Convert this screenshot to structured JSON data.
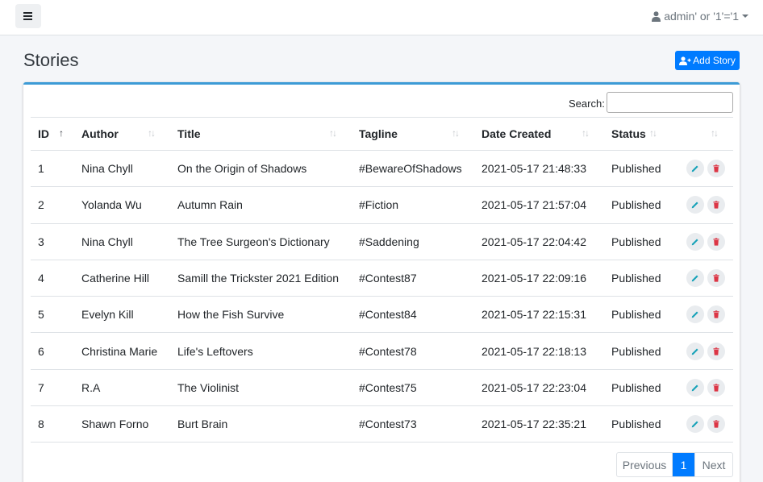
{
  "navbar": {
    "user_label": "admin' or '1'='1"
  },
  "page": {
    "title": "Stories",
    "add_button_label": "Add Story"
  },
  "search": {
    "label": "Search:",
    "value": ""
  },
  "table": {
    "columns": [
      "ID",
      "Author",
      "Title",
      "Tagline",
      "Date Created",
      "Status",
      ""
    ],
    "sorted_column": "ID",
    "rows": [
      {
        "id": "1",
        "author": "Nina Chyll",
        "title": "On the Origin of Shadows",
        "tagline": "#BewareOfShadows",
        "date": "2021-05-17 21:48:33",
        "status": "Published"
      },
      {
        "id": "2",
        "author": "Yolanda Wu",
        "title": "Autumn Rain",
        "tagline": "#Fiction",
        "date": "2021-05-17 21:57:04",
        "status": "Published"
      },
      {
        "id": "3",
        "author": "Nina Chyll",
        "title": "The Tree Surgeon's Dictionary",
        "tagline": "#Saddening",
        "date": "2021-05-17 22:04:42",
        "status": "Published"
      },
      {
        "id": "4",
        "author": "Catherine Hill",
        "title": "Samill the Trickster 2021 Edition",
        "tagline": "#Contest87",
        "date": "2021-05-17 22:09:16",
        "status": "Published"
      },
      {
        "id": "5",
        "author": "Evelyn Kill",
        "title": "How the Fish Survive",
        "tagline": "#Contest84",
        "date": "2021-05-17 22:15:31",
        "status": "Published"
      },
      {
        "id": "6",
        "author": "Christina Marie",
        "title": "Life's Leftovers",
        "tagline": "#Contest78",
        "date": "2021-05-17 22:18:13",
        "status": "Published"
      },
      {
        "id": "7",
        "author": "R.A",
        "title": "The Violinist",
        "tagline": "#Contest75",
        "date": "2021-05-17 22:23:04",
        "status": "Published"
      },
      {
        "id": "8",
        "author": "Shawn Forno",
        "title": "Burt Brain",
        "tagline": "#Contest73",
        "date": "2021-05-17 22:35:21",
        "status": "Published"
      }
    ],
    "row_actions": [
      "pencil-icon",
      "trash-icon"
    ]
  },
  "pagination": {
    "previous_label": "Previous",
    "current_page": "1",
    "next_label": "Next"
  },
  "colors": {
    "primary": "#007bff",
    "card_accent": "#3c9bd6",
    "edit_icon": "#17a2b8",
    "delete_icon": "#dc3545"
  }
}
